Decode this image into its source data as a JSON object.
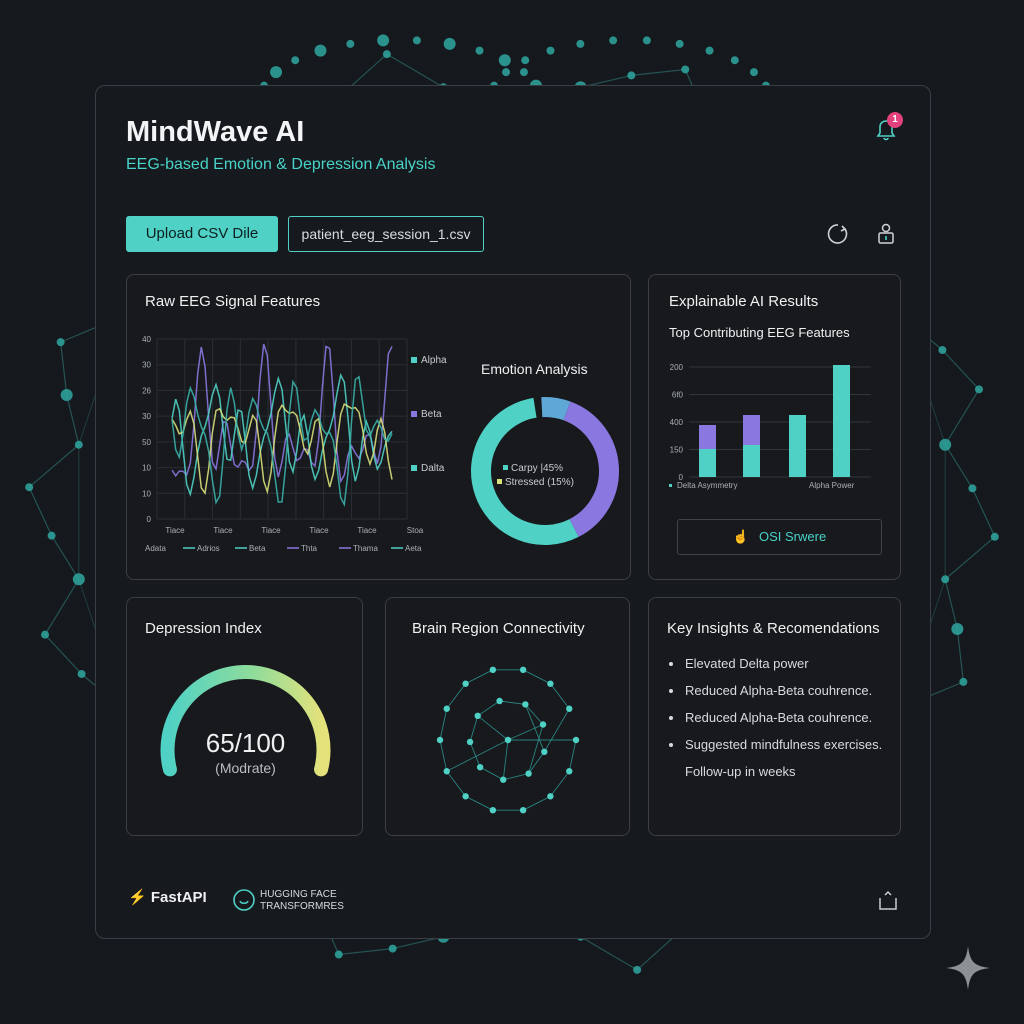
{
  "app": {
    "title": "MindWave AI",
    "subtitle": "EEG-based Emotion & Depression Analysis",
    "notification_count": "1"
  },
  "toolbar": {
    "upload_label": "Upload CSV Dile",
    "file_name": "patient_eeg_session_1.csv",
    "icons": [
      "refresh-icon",
      "user-lock-icon"
    ]
  },
  "raw_eeg": {
    "title": "Raw EEG Signal Features",
    "y_ticks": [
      "40",
      "30",
      "26",
      "30",
      "50",
      "10",
      "10",
      "0"
    ],
    "x_ticks": [
      "Tiace",
      "Tiace",
      "Tiace",
      "Tiace",
      "Tiace",
      "Stoa"
    ],
    "legend_right": [
      "Alpha",
      "Beta",
      "Dalta"
    ],
    "legend_bottom": [
      "Adata",
      "Adrios",
      "Beta",
      "Thta",
      "Thama",
      "Aeta"
    ]
  },
  "emotion": {
    "title": "Emotion Analysis",
    "labels": [
      "Carpy |45%",
      "Stressed (15%)"
    ]
  },
  "xai": {
    "title": "Explainable AI Results",
    "subtitle": "Top Contributing EEG Features",
    "y_ticks": [
      "200",
      "6f0",
      "400",
      "150",
      "0"
    ],
    "x_labels": [
      "Delta Asymmetry",
      "Alpha Power"
    ],
    "button_label": "OSI Srwere"
  },
  "depression": {
    "title": "Depression Index",
    "value": "65/100",
    "level": "(Modrate)",
    "score": 65
  },
  "brain": {
    "title": "Brain Region Connectivity"
  },
  "insights": {
    "title": "Key Insights & Recomendations",
    "items": [
      "Elevated Delta power",
      "Reduced Alpha-Beta couhrence.",
      "Reduced Alpha-Beta couhrence.",
      "Suggested mindfulness exercises.",
      "Follow-up in weeks"
    ]
  },
  "footer": {
    "fastapi": "FastAPI",
    "hf_line1": "HUGGING FACE",
    "hf_line2": "TRANSFORMRES"
  },
  "colors": {
    "accent": "#4fd1c5",
    "purple": "#8b77e0",
    "yellow": "#d8e07a",
    "badge": "#e3417b"
  }
}
